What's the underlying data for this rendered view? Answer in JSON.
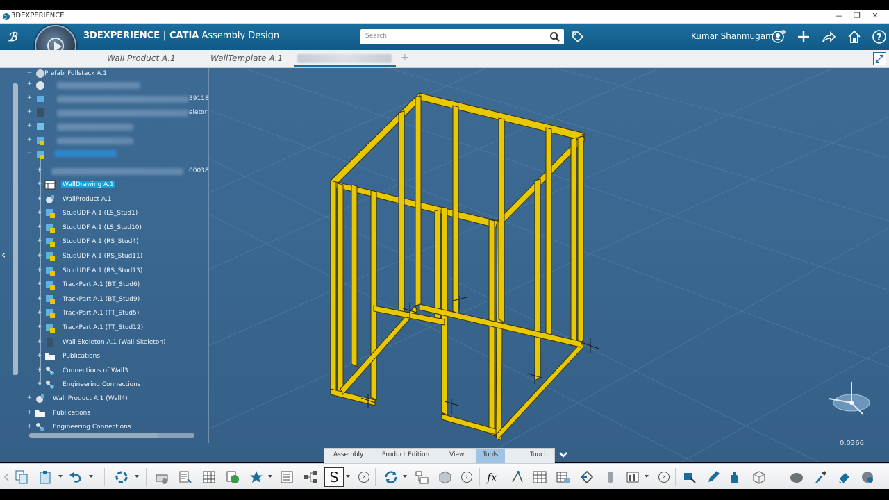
{
  "os_window": {
    "title": "3DEXPERIENCE",
    "controls": [
      "—",
      "❐",
      "✕"
    ]
  },
  "header": {
    "brand_prefix": "3DEXPERIENCE | ",
    "brand_app": "CATIA",
    "brand_suffix": " Assembly Design",
    "search_placeholder": "Search",
    "user_name": "Kumar Shanmugam",
    "icons": [
      "ds-logo-icon",
      "compass-icon",
      "search-icon",
      "tag-icon",
      "user-icon",
      "add-icon",
      "share-icon",
      "home-icon",
      "help-icon"
    ]
  },
  "tabs": [
    {
      "label": "Wall Product A.1"
    },
    {
      "label": "WallTemplate A.1"
    }
  ],
  "tree": {
    "root": "Prefab_Fullstack A.1",
    "partial_1": "39118",
    "partial_2": "eletor",
    "partial_3": "00038",
    "items": [
      {
        "label": "WallDrawing A.1",
        "selected": true,
        "icon": "drawing-icon"
      },
      {
        "label": "WallProduct A.1",
        "icon": "product-icon"
      },
      {
        "label": "StudUDF A.1 (LS_Stud1)",
        "icon": "udf-icon"
      },
      {
        "label": "StudUDF A.1 (LS_Stud10)",
        "icon": "udf-icon"
      },
      {
        "label": "StudUDF A.1 (RS_Stud4)",
        "icon": "udf-icon"
      },
      {
        "label": "StudUDF A.1 (RS_Stud11)",
        "icon": "udf-icon"
      },
      {
        "label": "StudUDF A.1 (RS_Stud13)",
        "icon": "udf-icon"
      },
      {
        "label": "TrackPart A.1 (BT_Stud6)",
        "icon": "udf-icon"
      },
      {
        "label": "TrackPart A.1 (BT_Stud9)",
        "icon": "udf-icon"
      },
      {
        "label": "TrackPart A.1 (TT_Stud5)",
        "icon": "udf-icon"
      },
      {
        "label": "TrackPart A.1 (TT_Stud12)",
        "icon": "udf-icon"
      },
      {
        "label": "Wall Skeleton A.1 (Wall Skeleton)",
        "icon": "skeleton-icon"
      },
      {
        "label": "Publications",
        "icon": "publications-icon"
      },
      {
        "label": "Connections of Wall3",
        "icon": "connections-icon"
      },
      {
        "label": "Engineering Connections",
        "icon": "connections-icon"
      }
    ],
    "root_items": [
      {
        "label": "Wall Product A.1 (Wall4)",
        "icon": "product-icon"
      },
      {
        "label": "Publications",
        "icon": "publications-icon"
      },
      {
        "label": "Engineering Connections",
        "icon": "connections-icon"
      }
    ]
  },
  "viewport": {
    "zoom_readout": "0.0366",
    "model_color": "#e8c800"
  },
  "ribbon_tabs": [
    {
      "label": "Assembly"
    },
    {
      "label": "Product Edition"
    },
    {
      "label": "View"
    },
    {
      "label": "Tools",
      "active": true
    },
    {
      "label": "Touch"
    }
  ],
  "toolbar": {
    "s_label": "S"
  }
}
